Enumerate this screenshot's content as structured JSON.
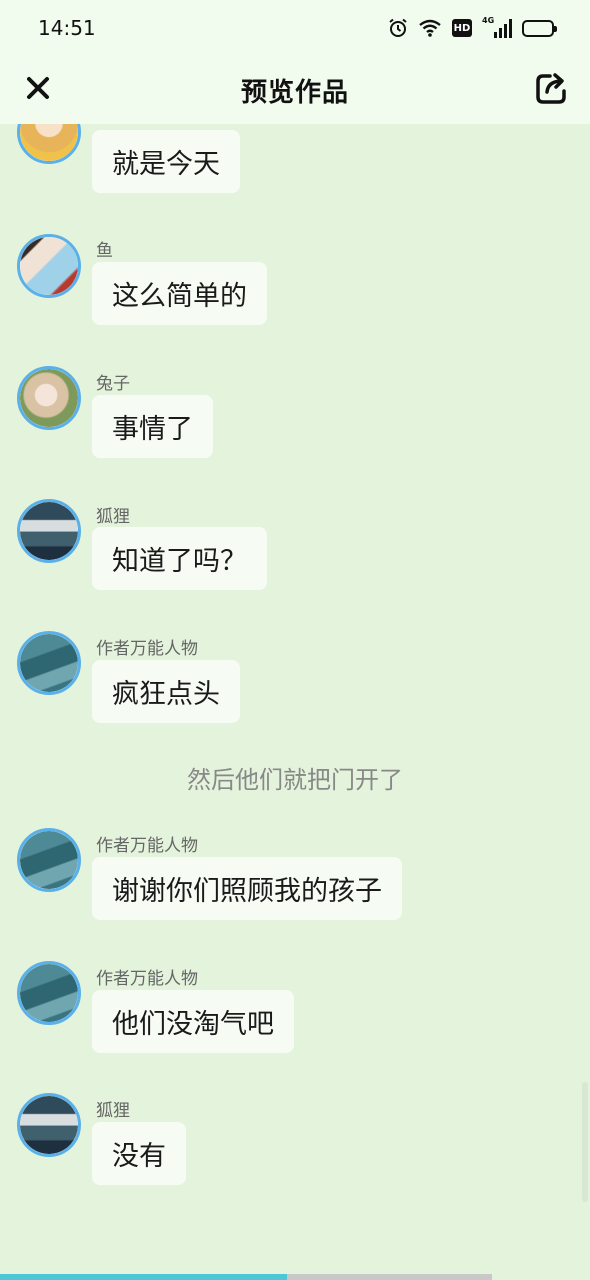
{
  "status_bar": {
    "time": "14:51",
    "hd_label": "HD",
    "network_label": "4G",
    "icons": [
      "alarm-icon",
      "wifi-icon",
      "hd-icon",
      "signal-4g-icon",
      "battery-icon"
    ]
  },
  "header": {
    "title": "预览作品",
    "close_icon": "close-icon",
    "share_icon": "share-icon"
  },
  "messages": [
    {
      "name": "",
      "text": "就是今天",
      "avatar": "avatar-yellow"
    },
    {
      "name": "鱼",
      "text": "这么简单的",
      "avatar": "avatar-fish"
    },
    {
      "name": "兔子",
      "text": "事情了",
      "avatar": "avatar-rabbit"
    },
    {
      "name": "狐狸",
      "text": "知道了吗？",
      "avatar": "avatar-fox"
    },
    {
      "name": "作者万能人物",
      "text": "疯狂点头",
      "avatar": "avatar-author"
    },
    {
      "narration": "然后他们就把门开了"
    },
    {
      "name": "作者万能人物",
      "text": "谢谢你们照顾我的孩子",
      "avatar": "avatar-author"
    },
    {
      "name": "作者万能人物",
      "text": "他们没淘气吧",
      "avatar": "avatar-author"
    },
    {
      "name": "狐狸",
      "text": "没有",
      "avatar": "avatar-fox"
    }
  ],
  "colors": {
    "background": "#e4f3dc",
    "header_bg": "#f1fbee",
    "bubble_bg": "#f6fcf4",
    "avatar_ring": "#5ab0e8",
    "progress": "#4ec6d6"
  },
  "playback_progress": 0.7
}
